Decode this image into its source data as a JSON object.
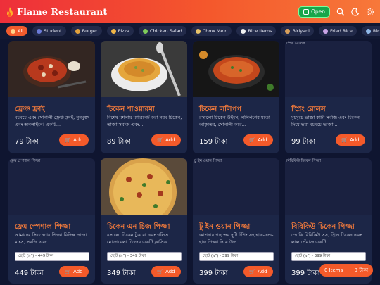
{
  "header": {
    "title": "Flame Restaurant",
    "open_label": "Open"
  },
  "categories": [
    "All",
    "Student",
    "Burger",
    "Pizza",
    "Chicken Salad",
    "Chow Mein",
    "Rice Items",
    "Biriyani",
    "Fried Rice",
    "Rice Bowl"
  ],
  "add_label": "Add",
  "items": [
    {
      "title": "ফ্রেঞ্চ ফ্রাই",
      "desc": "মচমচে এবং সোনালী ফ্রেঞ্চ ফ্রাই, নুনমুক্ত এবং অনলাইনে। একটি...",
      "price": "79 টাকা",
      "img_alt": ""
    },
    {
      "title": "চিকেন শাওয়ারমা",
      "desc": "বিশেষ মশলায় ম্যারিনেট করা নরম চিকেন, তাজা সবজি এবং...",
      "price": "89 টাকা",
      "img_alt": ""
    },
    {
      "title": "চিকেন ললিপপ",
      "desc": "রসালো চিকেন উইংস, ললিপপের মতো আকৃতির, সোনালী করে...",
      "price": "159 টাকা",
      "img_alt": ""
    },
    {
      "title": "স্প্রিং রোলস",
      "desc": "মুচমুচে ভাজা কাটা সবজি এবং চিকেন দিয়ে ভরা মচমচে ভাজা...",
      "price": "99 টাকা",
      "img_alt": "স্প্রিং রোলস"
    },
    {
      "title": "ফ্লেম স্পেশাল পিজ্জা",
      "desc": "আমাদের সিগনেচার পিজ্জা বিভিন্ন তাজা মাংস, সবজি এবং...",
      "price": "449 টাকা",
      "size": "ছোট (৯\") - 449 টাকা",
      "img_alt": "ফ্লেম স্পেশাল পিজ্জা"
    },
    {
      "title": "চিকেন এন চিজ পিজ্জা",
      "desc": "রসালো চিকেন টুকরো এবং গলিত মোজারেলা চিজের একটি ক্লাসিক...",
      "price": "349 টাকা",
      "size": "ছোট (৯\") - 349 টাকা",
      "img_alt": ""
    },
    {
      "title": "টু ইন ওয়ান পিজ্জা",
      "desc": "আপনার পছন্দের দুটি টপিং সহ হাফ-এন্ড-হাফ পিজ্জা দিয়ে উভ...",
      "price": "399 টাকা",
      "size": "ছোট (৯\") - 399 টাকা",
      "img_alt": "টু ইন ওয়ান পিজ্জা"
    },
    {
      "title": "বিবিকিউ চিকেন পিজ্জা",
      "desc": "স্মোকি বিবিকিউ সস, গ্রিল্ড চিকেন এবং লাল পেঁয়াজ একটি...",
      "price": "399 টাকা",
      "size": "ছোট (৯\") - 399 টাকা",
      "img_alt": "বিবিকিউ চিকেন পিজ্জা"
    }
  ],
  "cart": {
    "items_label": "0 Items",
    "total": "0 টাকা"
  },
  "colors": {
    "accent": "#f45a2a",
    "title": "#f47b3c",
    "card": "#1c2647",
    "bg": "#0f1530"
  },
  "icons": {
    "logo": "flame-icon",
    "search": "search-icon",
    "theme": "moon-icon",
    "settings": "gear-icon",
    "cart": "cart-icon"
  }
}
